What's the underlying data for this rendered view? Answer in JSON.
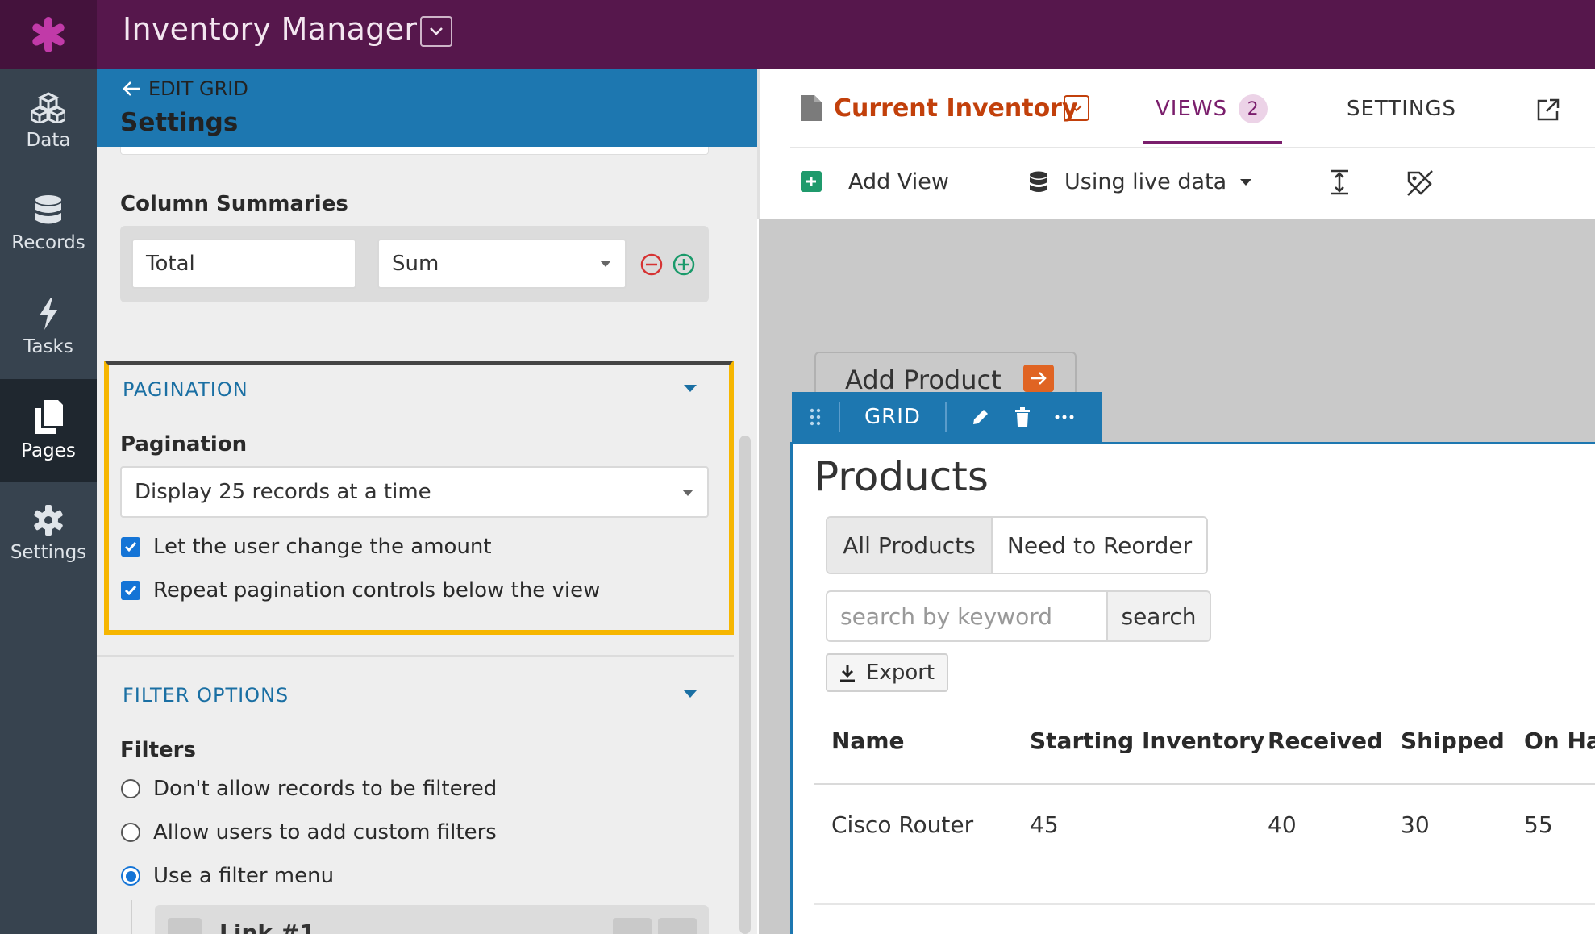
{
  "app": {
    "title": "Inventory Manager"
  },
  "nav": [
    {
      "label": "Data",
      "icon": "cubes-icon"
    },
    {
      "label": "Records",
      "icon": "database-icon"
    },
    {
      "label": "Tasks",
      "icon": "bolt-icon"
    },
    {
      "label": "Pages",
      "icon": "pages-icon",
      "active": true
    },
    {
      "label": "Settings",
      "icon": "gear-icon"
    }
  ],
  "panel": {
    "back_label": "EDIT GRID",
    "title": "Settings",
    "column_summaries": {
      "label": "Column Summaries",
      "name_value": "Total",
      "function_value": "Sum"
    },
    "pagination": {
      "section_title": "PAGINATION",
      "label": "Pagination",
      "select_value": "Display 25 records at a time",
      "options": [
        {
          "label": "Let the user change the amount",
          "checked": true
        },
        {
          "label": "Repeat pagination controls below the view",
          "checked": true
        }
      ]
    },
    "filter_options": {
      "section_title": "FILTER OPTIONS",
      "label": "Filters",
      "options": [
        {
          "label": "Don't allow records to be filtered",
          "selected": false
        },
        {
          "label": "Allow users to add custom filters",
          "selected": false
        },
        {
          "label": "Use a filter menu",
          "selected": true
        }
      ],
      "menu_item_partial": "Link #1"
    }
  },
  "view": {
    "title": "Current Inventory",
    "tabs": {
      "views_label": "VIEWS",
      "views_count": "2",
      "settings_label": "SETTINGS"
    },
    "toolbar": {
      "add_view": "Add View",
      "data_mode": "Using live data"
    }
  },
  "canvas": {
    "add_product_label": "Add Product",
    "grid_bar_label": "GRID",
    "products_title": "Products",
    "filter_tabs": [
      "All Products",
      "Need to Reorder"
    ],
    "search": {
      "placeholder": "search by keyword",
      "button": "search"
    },
    "export_label": "Export",
    "table": {
      "headers": [
        "Name",
        "Starting Inventory",
        "Received",
        "Shipped",
        "On Ha"
      ],
      "rows": [
        [
          "Cisco Router",
          "45",
          "40",
          "30",
          "55"
        ]
      ]
    }
  },
  "colors": {
    "topbar": "#56174c",
    "nav": "#37434f",
    "panel_header": "#1d77b0",
    "highlight": "#f6b600",
    "view_title": "#c2400b",
    "views_tab": "#7a1e6c"
  }
}
